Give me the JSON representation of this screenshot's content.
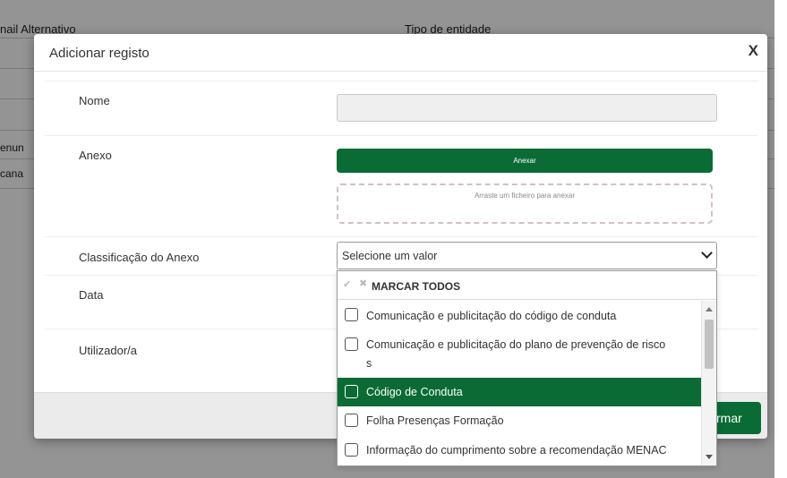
{
  "background": {
    "col_email": "nail Alternativo",
    "col_entity_type": "Tipo de entidade",
    "row_fragment_1": "enun",
    "row_fragment_2": "cana"
  },
  "modal": {
    "title": "Adicionar registo",
    "close_label": "X",
    "fields": {
      "name_label": "Nome",
      "attachment_label": "Anexo",
      "attach_button": "Anexar",
      "drop_zone_text": "Arraste um ficheiro para anexar",
      "classification_label": "Classificação do Anexo",
      "classification_placeholder": "Selecione um valor",
      "date_label": "Data",
      "user_label": "Utilizador/a"
    },
    "footer": {
      "confirm_label": "rmar"
    }
  },
  "dropdown": {
    "mark_all": "MARCAR TODOS",
    "check_icon": "✔",
    "clear_icon": "✖",
    "items": [
      {
        "line1": "Comunicação e publicitação do código de conduta",
        "line2": ""
      },
      {
        "line1": "Comunicação e publicitação do plano de prevenção de risco",
        "line2": "s"
      },
      {
        "line1": "Código de Conduta",
        "line2": ""
      },
      {
        "line1": "Folha Presenças Formação",
        "line2": ""
      },
      {
        "line1": "Informação do cumprimento sobre a recomendação MENAC",
        "line2": ""
      }
    ],
    "highlighted_index": 2,
    "accent_color": "#0a6b34"
  }
}
